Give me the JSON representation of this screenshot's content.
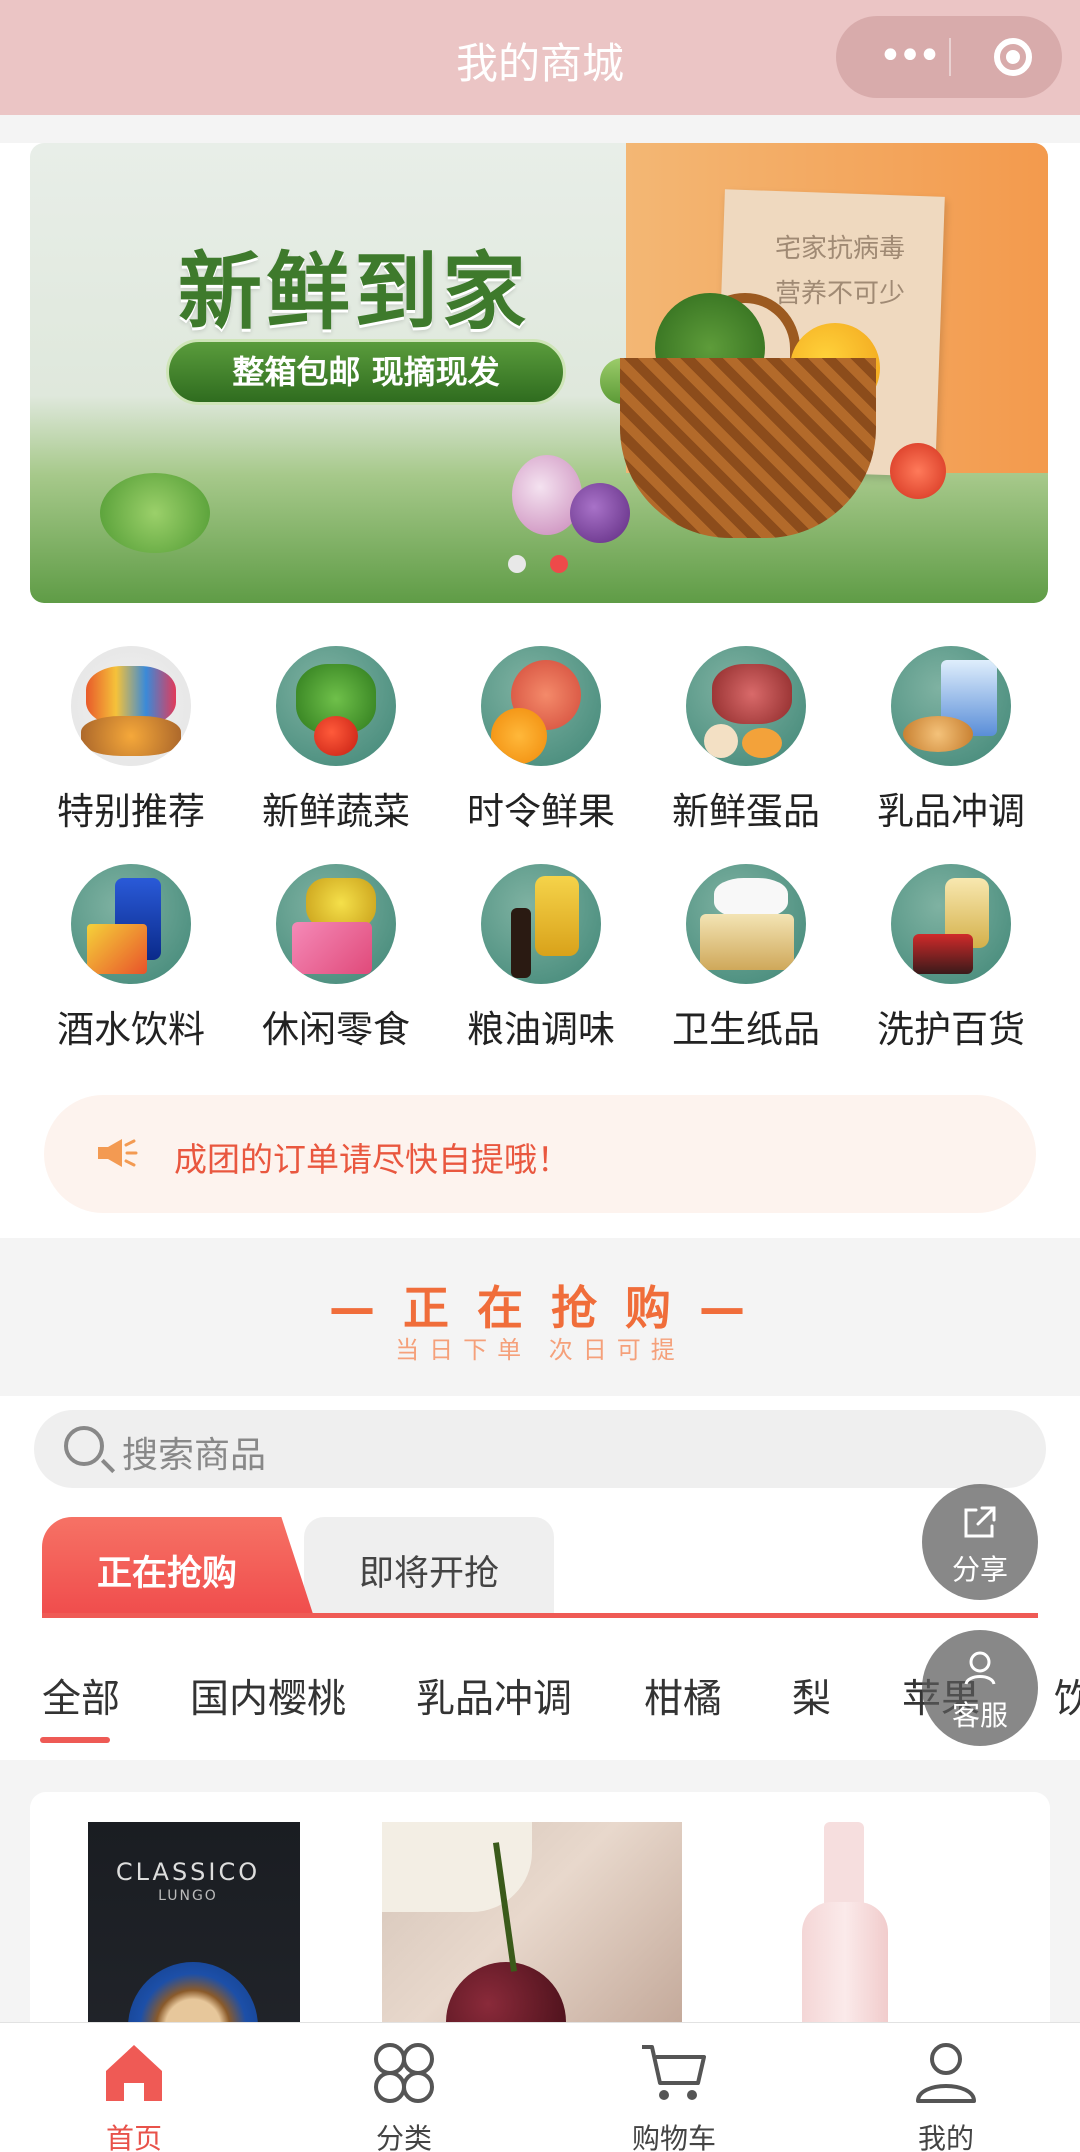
{
  "titlebar": {
    "title": "我的商城"
  },
  "banner": {
    "headline": "新鲜到家",
    "pill": "整箱包邮 现摘现发",
    "board_line1": "宅家抗病毒",
    "board_line2": "营养不可少",
    "slide_count": 2,
    "active_slide": 2
  },
  "categories": [
    {
      "label": "特别推荐",
      "icon": "snacks-assortment-icon"
    },
    {
      "label": "新鲜蔬菜",
      "icon": "vegetables-icon"
    },
    {
      "label": "时令鲜果",
      "icon": "fruit-icon"
    },
    {
      "label": "新鲜蛋品",
      "icon": "meat-eggs-icon"
    },
    {
      "label": "乳品冲调",
      "icon": "dairy-icon"
    },
    {
      "label": "酒水饮料",
      "icon": "drinks-icon"
    },
    {
      "label": "休闲零食",
      "icon": "snacks-icon"
    },
    {
      "label": "粮油调味",
      "icon": "oil-seasoning-icon"
    },
    {
      "label": "卫生纸品",
      "icon": "tissue-icon"
    },
    {
      "label": "洗护百货",
      "icon": "toiletries-icon"
    }
  ],
  "notice": {
    "text": "成团的订单请尽快自提哦！"
  },
  "section": {
    "title": "— 正 在 抢 购 —",
    "subtitle": "当日下单  次日可提"
  },
  "search": {
    "placeholder": "搜索商品"
  },
  "tabs": [
    {
      "label": "正在抢购",
      "active": true
    },
    {
      "label": "即将开抢",
      "active": false
    }
  ],
  "subcategories": [
    "全部",
    "国内樱桃",
    "乳品冲调",
    "柑橘",
    "梨",
    "苹果",
    "饮"
  ],
  "fab": {
    "share": "分享",
    "service": "客服"
  },
  "products": [
    {
      "brand_text": "CLASSICO",
      "sub_text": "LUNGO"
    },
    {
      "brand_text": ""
    },
    {
      "brand_text": ""
    }
  ],
  "bottom_nav": [
    {
      "label": "首页",
      "active": true,
      "color": "#e8524a"
    },
    {
      "label": "分类",
      "active": false,
      "color": "#555555"
    },
    {
      "label": "购物车",
      "active": false,
      "color": "#555555"
    },
    {
      "label": "我的",
      "active": false,
      "color": "#555555"
    }
  ],
  "colors": {
    "accent": "#ef5a55",
    "titlebar": "#ebc5c5"
  }
}
